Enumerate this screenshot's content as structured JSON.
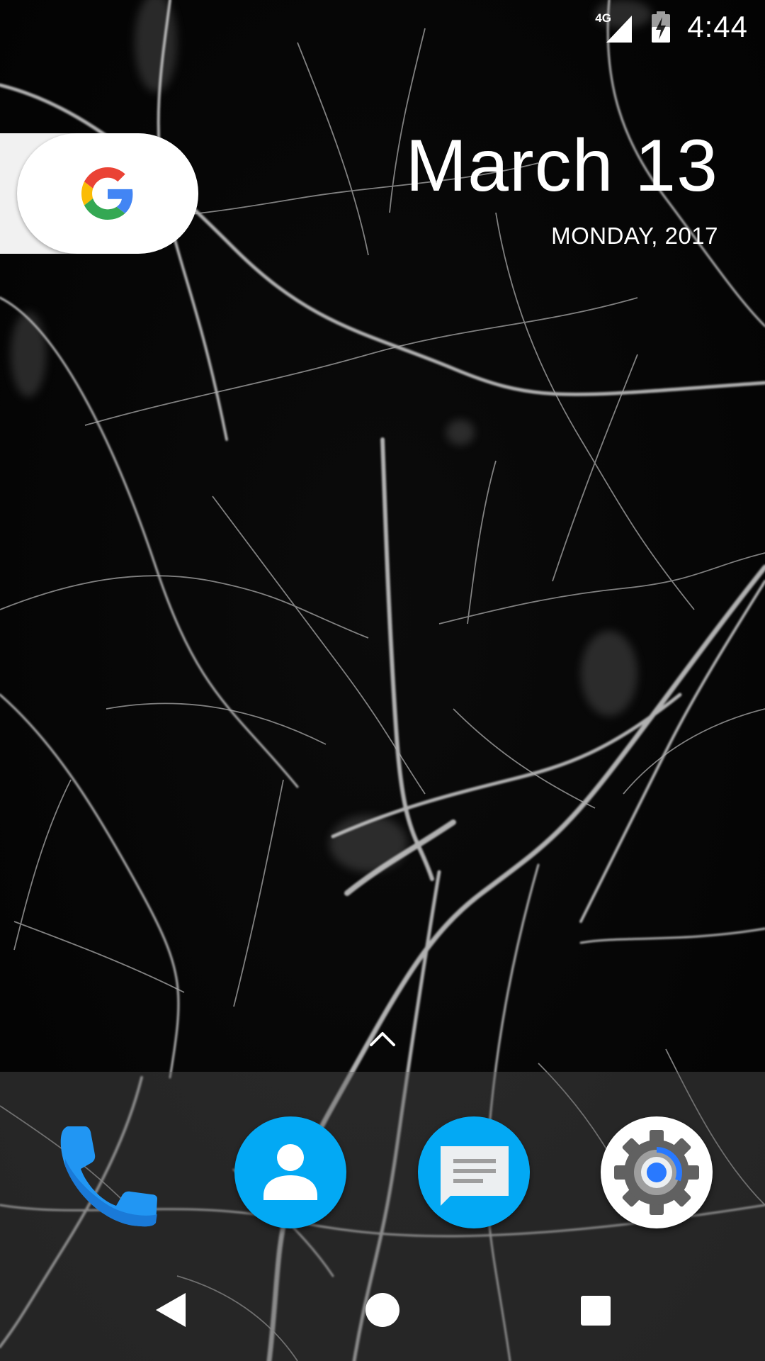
{
  "status_bar": {
    "network_type": "4G",
    "time": "4:44"
  },
  "date_widget": {
    "date": "March 13",
    "weekday_year": "MONDAY, 2017"
  },
  "google_search": {
    "icon": "google-g-icon"
  },
  "dock": {
    "apps": [
      {
        "name": "Phone",
        "icon": "phone-icon",
        "color": "#2196F3"
      },
      {
        "name": "Contacts",
        "icon": "contacts-icon",
        "color": "#03A9F4"
      },
      {
        "name": "Messages",
        "icon": "messages-icon",
        "color": "#03A9F4"
      },
      {
        "name": "Settings",
        "icon": "settings-gear-icon",
        "color": "#607D8B"
      }
    ]
  },
  "navigation": {
    "back": "back-triangle-icon",
    "home": "home-circle-icon",
    "recents": "recents-square-icon"
  },
  "colors": {
    "google_blue": "#4285F4",
    "google_red": "#EA4335",
    "google_yellow": "#FBBC05",
    "google_green": "#34A853",
    "phone_blue": "#2196F3",
    "contacts_blue": "#03A9F4",
    "settings_accent": "#2979FF"
  }
}
